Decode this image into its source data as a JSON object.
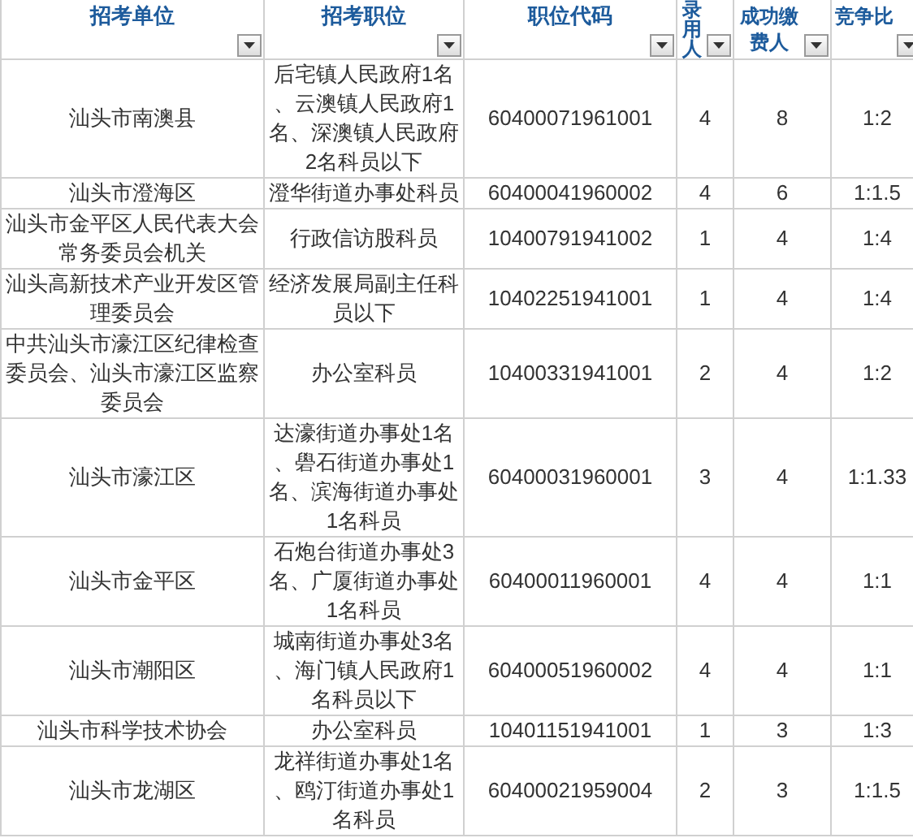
{
  "table": {
    "columns": [
      {
        "label": "招考单位"
      },
      {
        "label": "招考职位"
      },
      {
        "label": "职位代码"
      },
      {
        "label": "录用人"
      },
      {
        "label": "成功缴费人"
      },
      {
        "label": "竞争比"
      }
    ],
    "rows": [
      [
        "汕头市南澳县",
        "后宅镇人民政府1名、云澳镇人民政府1名、深澳镇人民政府2名科员以下",
        "60400071961001",
        "4",
        "8",
        "1:2"
      ],
      [
        "汕头市澄海区",
        "澄华街道办事处科员",
        "60400041960002",
        "4",
        "6",
        "1:1.5"
      ],
      [
        "汕头市金平区人民代表大会常务委员会机关",
        "行政信访股科员",
        "10400791941002",
        "1",
        "4",
        "1:4"
      ],
      [
        "汕头高新技术产业开发区管理委员会",
        "经济发展局副主任科员以下",
        "10402251941001",
        "1",
        "4",
        "1:4"
      ],
      [
        "中共汕头市濠江区纪律检查委员会、汕头市濠江区监察委员会",
        "办公室科员",
        "10400331941001",
        "2",
        "4",
        "1:2"
      ],
      [
        "汕头市濠江区",
        "达濠街道办事处1名、礐石街道办事处1名、滨海街道办事处1名科员",
        "60400031960001",
        "3",
        "4",
        "1:1.33"
      ],
      [
        "汕头市金平区",
        "石炮台街道办事处3名、广厦街道办事处1名科员",
        "60400011960001",
        "4",
        "4",
        "1:1"
      ],
      [
        "汕头市潮阳区",
        "城南街道办事处3名、海门镇人民政府1名科员以下",
        "60400051960002",
        "4",
        "4",
        "1:1"
      ],
      [
        "汕头市科学技术协会",
        "办公室科员",
        "10401151941001",
        "1",
        "3",
        "1:3"
      ],
      [
        "汕头市龙湖区",
        "龙祥街道办事处1名、鸥汀街道办事处1名科员",
        "60400021959004",
        "2",
        "3",
        "1:1.5"
      ]
    ]
  }
}
